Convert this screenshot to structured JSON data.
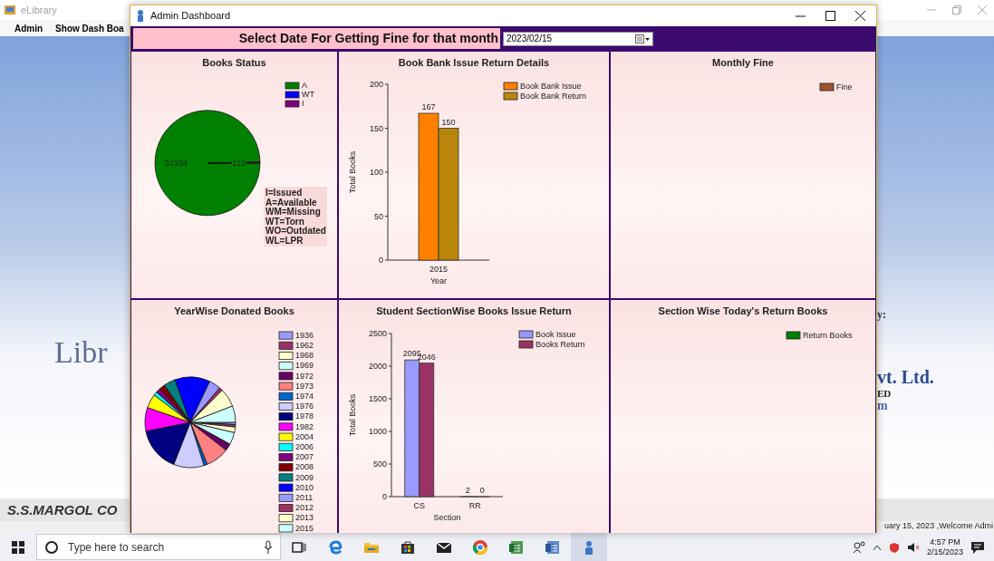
{
  "background_window": {
    "title": "eLibrary",
    "menu": [
      "Admin",
      "Show Dash Boa"
    ],
    "left_text": "Libr",
    "right_texts": [
      "y:",
      "vt. Ltd.",
      "ED",
      "m"
    ],
    "banner": "S.S.MARGOL CO",
    "status": "uary 15, 2023 ,Welcome Admi"
  },
  "window": {
    "title": "Admin Dashboard"
  },
  "date_filter": {
    "label": "Select Date For Getting Fine for that month",
    "value": "2023/02/15"
  },
  "panels": [
    {
      "kind": "chart",
      "title": "Books Status",
      "chart_data": {
        "type": "pie",
        "categories": [
          "A",
          "WT",
          "I"
        ],
        "values": [
          32104,
          0,
          113
        ],
        "colors": [
          "#008000",
          "#0000ff",
          "#800080"
        ],
        "legend": "top-right",
        "data_labels": true
      },
      "notes": [
        "I=Issued",
        "A=Available",
        "WM=Missing",
        "WT=Torn",
        "WO=Outdated",
        "WL=LPR"
      ]
    },
    {
      "kind": "chart",
      "title": "Book Bank Issue Return Details",
      "chart_data": {
        "type": "bar",
        "legend": "top-right",
        "xlabel": "Year",
        "ylabel": "Total Books",
        "categories": [
          "2015"
        ],
        "series": [
          {
            "name": "Book Bank Issue",
            "color": "#ff8000",
            "values": [
              167
            ]
          },
          {
            "name": "Book Bank Return",
            "color": "#b8860b",
            "values": [
              150
            ]
          }
        ],
        "ylim": [
          0,
          200
        ],
        "yticks": [
          0,
          50,
          100,
          150,
          200
        ],
        "data_labels": true
      }
    },
    {
      "kind": "legend",
      "title": "Monthly Fine",
      "legend": [
        {
          "label": "Fine",
          "color": "#a0522d"
        }
      ]
    },
    {
      "kind": "pie_picture",
      "title": "YearWise Donated Books",
      "legend": [
        {
          "label": "1936",
          "color": "#9999ff"
        },
        {
          "label": "1962",
          "color": "#993366"
        },
        {
          "label": "1968",
          "color": "#ffffcc"
        },
        {
          "label": "1969",
          "color": "#ccffff"
        },
        {
          "label": "1972",
          "color": "#660066"
        },
        {
          "label": "1973",
          "color": "#ff8080"
        },
        {
          "label": "1974",
          "color": "#0066cc"
        },
        {
          "label": "1976",
          "color": "#ccccff"
        },
        {
          "label": "1978",
          "color": "#000080"
        },
        {
          "label": "1982",
          "color": "#ff00ff"
        },
        {
          "label": "2004",
          "color": "#ffff00"
        },
        {
          "label": "2006",
          "color": "#00ffff"
        },
        {
          "label": "2007",
          "color": "#800080"
        },
        {
          "label": "2008",
          "color": "#800000"
        },
        {
          "label": "2009",
          "color": "#008080"
        },
        {
          "label": "2010",
          "color": "#0000ff"
        },
        {
          "label": "2011",
          "color": "#9999fe"
        },
        {
          "label": "2012",
          "color": "#993367"
        },
        {
          "label": "2013",
          "color": "#ffffcd"
        },
        {
          "label": "2015",
          "color": "#ccfffe"
        }
      ]
    },
    {
      "kind": "chart",
      "title": "Student SectionWise Books Issue Return",
      "chart_data": {
        "type": "bar",
        "legend": "top-right",
        "xlabel": "Section",
        "ylabel": "Total Books",
        "categories": [
          "CS",
          "RR"
        ],
        "series": [
          {
            "name": "Book Issue",
            "color": "#9999ff",
            "values": [
              2095,
              2
            ]
          },
          {
            "name": "Books Return",
            "color": "#993366",
            "values": [
              2046,
              0
            ]
          }
        ],
        "ylim": [
          0,
          2500
        ],
        "yticks": [
          0,
          500,
          1000,
          1500,
          2000,
          2500
        ],
        "data_labels": true
      }
    },
    {
      "kind": "legend",
      "title": "Section Wise Today's Return Books",
      "legend": [
        {
          "label": "Return Books",
          "color": "#008000"
        }
      ]
    }
  ],
  "taskbar": {
    "search_placeholder": "Type here to search",
    "time": "4:57 PM",
    "date": "2/15/2023"
  }
}
